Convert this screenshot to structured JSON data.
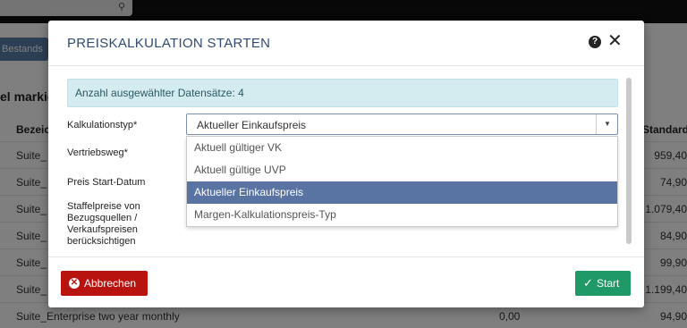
{
  "background": {
    "search_icon": "search-icon",
    "tab_label": "Bestands",
    "heading": "el markie",
    "col_left": "Bezeic",
    "col_right": "Standard",
    "rows": [
      {
        "name": "Suite_",
        "mid": "",
        "value": "959,40"
      },
      {
        "name": "Suite_",
        "mid": "",
        "value": "74,90"
      },
      {
        "name": "Suite_",
        "mid": "",
        "value": "1.079,40"
      },
      {
        "name": "Suite_",
        "mid": "",
        "value": "84,90"
      },
      {
        "name": "Suite_",
        "mid": "",
        "value": "99,90"
      },
      {
        "name": "Suite_",
        "mid": "",
        "value": "1.199,40"
      },
      {
        "name": "Suite_Enterprise two year monthly",
        "mid": "0,00",
        "value": "94,90"
      }
    ]
  },
  "modal": {
    "title": "PREISKALKULATION STARTEN",
    "help_icon": "?",
    "close_icon": "✕",
    "info": "Anzahl ausgewählter Datensätze: 4",
    "labels": {
      "kalkulationstyp": "Kalkulationstyp*",
      "vertriebsweg": "Vertriebsweg*",
      "preis_start": "Preis Start-Datum",
      "staffelpreise": "Staffelpreise von Bezugsquellen / Verkaufspreisen berücksichtigen"
    },
    "select_value": "Aktueller Einkaufspreis",
    "options": [
      "Aktuell gültiger VK",
      "Aktuell gültige UVP",
      "Aktueller Einkaufspreis",
      "Margen-Kalkulationspreis-Typ"
    ],
    "selected_option_index": 2,
    "cancel_label": "Abbrechen",
    "start_label": "Start"
  },
  "colors": {
    "title": "#2f4a73",
    "selected_option": "#5973a3",
    "cancel": "#b8130f",
    "start": "#1f9a67",
    "info_bg": "#d4ecef"
  }
}
